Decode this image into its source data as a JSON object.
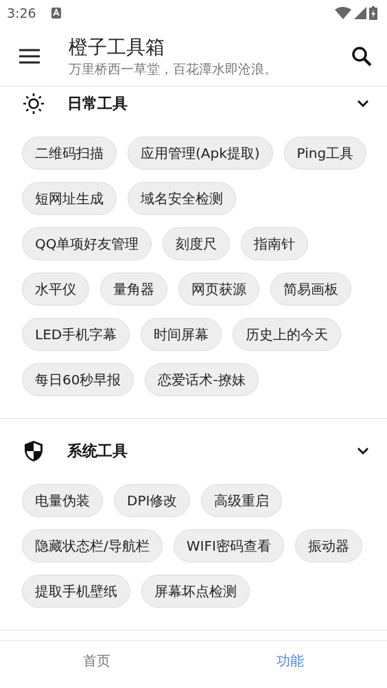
{
  "status_bar": {
    "time": "3:26"
  },
  "app_bar": {
    "title": "橙子工具箱",
    "subtitle": "万里桥西一草堂，百花潭水即沧浪。"
  },
  "sections": [
    {
      "kind": "daily",
      "title": "日常工具",
      "tools": [
        "二维码扫描",
        "应用管理(Apk提取)",
        "Ping工具",
        "短网址生成",
        "域名安全检测",
        "QQ单项好友管理",
        "刻度尺",
        "指南针",
        "水平仪",
        "量角器",
        "网页获源",
        "简易画板",
        "LED手机字幕",
        "时间屏幕",
        "历史上的今天",
        "每日60秒早报",
        "恋爱话术-撩妹"
      ]
    },
    {
      "kind": "system",
      "title": "系统工具",
      "tools": [
        "电量伪装",
        "DPI修改",
        "高级重启",
        "隐藏状态栏/导航栏",
        "WIFI密码查看",
        "振动器",
        "提取手机壁纸",
        "屏幕坏点检测"
      ]
    }
  ],
  "bottom_nav": [
    {
      "label": "首页",
      "selected": false
    },
    {
      "label": "功能",
      "selected": true
    }
  ]
}
